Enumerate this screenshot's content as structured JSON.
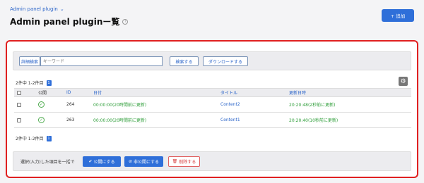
{
  "breadcrumb": {
    "label": "Admin panel plugin",
    "chevron": "⌄"
  },
  "header": {
    "title": "Admin panel pluginー覧",
    "help": "?",
    "add_label": "+ 追加"
  },
  "search": {
    "detail_label": "詳細検索",
    "keyword_placeholder": "キーワード",
    "search_label": "検索する",
    "download_label": "ダウンロードする"
  },
  "pagination": {
    "summary": "2件中 1-2件目",
    "page": "1"
  },
  "table": {
    "columns": [
      "公開",
      "ID",
      "日付",
      "タイトル",
      "更新日時"
    ],
    "rows": [
      {
        "id": "264",
        "date": "00:00:00(20時間前に更新)",
        "title": "Content2",
        "updated": "20:20:48(2秒前に更新)"
      },
      {
        "id": "263",
        "date": "00:00:00(20時間前に更新)",
        "title": "Content1",
        "updated": "20:20:40(10秒前に更新)"
      }
    ]
  },
  "bulk": {
    "label": "選択(入力)した項目を一括で",
    "publish_label": "公開にする",
    "unpublish_label": "非公開にする",
    "delete_label": "削除する"
  },
  "icons": {
    "gear": "gear-icon",
    "check": "check-circle-icon",
    "trash": "trash-icon",
    "help": "help-circle-icon"
  },
  "colors": {
    "accent": "#2f6fd9",
    "danger": "#e02020",
    "success": "#2f9e3a"
  }
}
